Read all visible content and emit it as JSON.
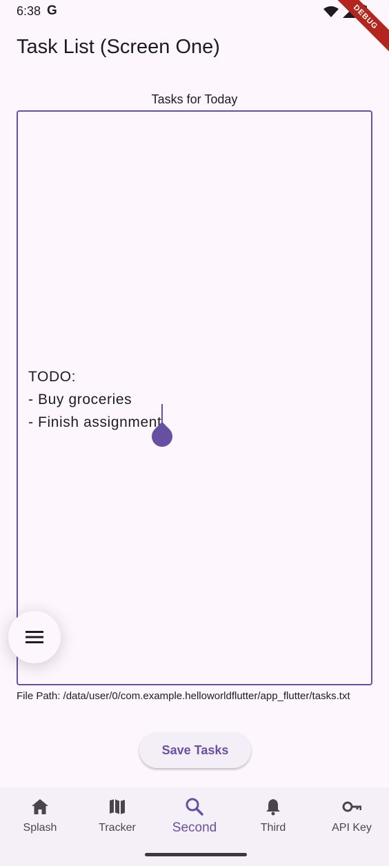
{
  "status_bar": {
    "time": "6:38",
    "google_badge": "G",
    "debug_label": "DEBUG"
  },
  "app_bar": {
    "title": "Task List (Screen One)"
  },
  "editor": {
    "label": "Tasks for Today",
    "lines": [
      "TODO:",
      "- Buy groceries",
      "- Finish assignment"
    ]
  },
  "file_path": "File Path: /data/user/0/com.example.helloworldflutter/app_flutter/tasks.txt",
  "save_button_label": "Save Tasks",
  "nav": {
    "items": [
      {
        "label": "Splash",
        "icon": "home-icon"
      },
      {
        "label": "Tracker",
        "icon": "map-icon"
      },
      {
        "label": "Second",
        "icon": "search-icon",
        "active": true
      },
      {
        "label": "Third",
        "icon": "bell-icon"
      },
      {
        "label": "API Key",
        "icon": "key-icon"
      }
    ]
  },
  "colors": {
    "accent": "#6750a4",
    "background": "#fdf7fd",
    "nav_background": "#f5eff7",
    "active_nav": "#6750a4"
  }
}
